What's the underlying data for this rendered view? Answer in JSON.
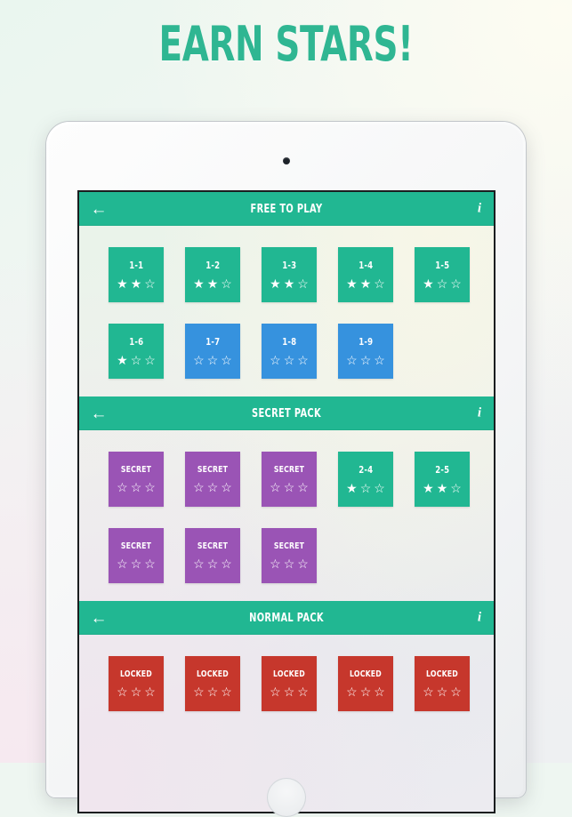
{
  "headline": "EARN STARS!",
  "colors": {
    "accent_teal": "#21b792",
    "tile_green": "#21b792",
    "tile_blue": "#3692de",
    "tile_purple": "#9a54b5",
    "tile_red": "#c6372c",
    "headline_teal": "#2fb692",
    "header_text": "#ffffff"
  },
  "icons": {
    "back_arrow": "←",
    "info": "i",
    "star_filled": "★",
    "star_empty": "☆"
  },
  "packs": [
    {
      "title": "FREE TO PLAY",
      "back_icon": "back-arrow-icon",
      "info_icon": "info-icon",
      "rows": [
        [
          {
            "label": "1-1",
            "color": "green",
            "stars_filled": 2,
            "stars_total": 3
          },
          {
            "label": "1-2",
            "color": "green",
            "stars_filled": 2,
            "stars_total": 3
          },
          {
            "label": "1-3",
            "color": "green",
            "stars_filled": 2,
            "stars_total": 3
          },
          {
            "label": "1-4",
            "color": "green",
            "stars_filled": 2,
            "stars_total": 3
          },
          {
            "label": "1-5",
            "color": "green",
            "stars_filled": 1,
            "stars_total": 3
          }
        ],
        [
          {
            "label": "1-6",
            "color": "green",
            "stars_filled": 1,
            "stars_total": 3
          },
          {
            "label": "1-7",
            "color": "blue",
            "stars_filled": 0,
            "stars_total": 3
          },
          {
            "label": "1-8",
            "color": "blue",
            "stars_filled": 0,
            "stars_total": 3
          },
          {
            "label": "1-9",
            "color": "blue",
            "stars_filled": 0,
            "stars_total": 3
          }
        ]
      ]
    },
    {
      "title": "SECRET PACK",
      "back_icon": "back-arrow-icon",
      "info_icon": "info-icon",
      "rows": [
        [
          {
            "label": "SECRET",
            "color": "purple",
            "stars_filled": 0,
            "stars_total": 3
          },
          {
            "label": "SECRET",
            "color": "purple",
            "stars_filled": 0,
            "stars_total": 3
          },
          {
            "label": "SECRET",
            "color": "purple",
            "stars_filled": 0,
            "stars_total": 3
          },
          {
            "label": "2-4",
            "color": "green",
            "stars_filled": 1,
            "stars_total": 3
          },
          {
            "label": "2-5",
            "color": "green",
            "stars_filled": 2,
            "stars_total": 3
          }
        ],
        [
          {
            "label": "SECRET",
            "color": "purple",
            "stars_filled": 0,
            "stars_total": 3
          },
          {
            "label": "SECRET",
            "color": "purple",
            "stars_filled": 0,
            "stars_total": 3
          },
          {
            "label": "SECRET",
            "color": "purple",
            "stars_filled": 0,
            "stars_total": 3
          }
        ]
      ]
    },
    {
      "title": "NORMAL PACK",
      "back_icon": "back-arrow-icon",
      "info_icon": "info-icon",
      "rows": [
        [
          {
            "label": "LOCKED",
            "color": "red",
            "stars_filled": 0,
            "stars_total": 3
          },
          {
            "label": "LOCKED",
            "color": "red",
            "stars_filled": 0,
            "stars_total": 3
          },
          {
            "label": "LOCKED",
            "color": "red",
            "stars_filled": 0,
            "stars_total": 3
          },
          {
            "label": "LOCKED",
            "color": "red",
            "stars_filled": 0,
            "stars_total": 3
          },
          {
            "label": "LOCKED",
            "color": "red",
            "stars_filled": 0,
            "stars_total": 3
          }
        ]
      ]
    }
  ]
}
